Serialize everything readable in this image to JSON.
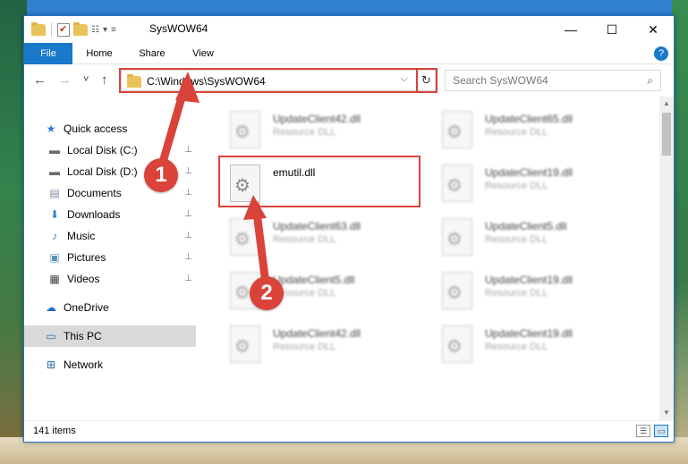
{
  "window": {
    "title": "SysWOW64",
    "controls": {
      "minimize": "—",
      "maximize": "☐",
      "close": "✕"
    },
    "qa_chevron": "▾"
  },
  "ribbon": {
    "tabs": [
      "File",
      "Home",
      "Share",
      "View"
    ],
    "help": "?"
  },
  "navigation": {
    "back": "←",
    "forward": "→",
    "recent": "˅",
    "up": "↑",
    "address": "C:\\Windows\\SysWOW64",
    "address_chevron": "⌵",
    "refresh": "↻",
    "search_placeholder": "Search SysWOW64",
    "search_icon": "⌕"
  },
  "sidebar": {
    "items": [
      {
        "label": "Quick access",
        "icon": "★",
        "color": "#2d7ad6",
        "pinned": false
      },
      {
        "label": "Local Disk (C:)",
        "icon": "▬",
        "color": "#6b6b6b",
        "pinned": true
      },
      {
        "label": "Local Disk (D:)",
        "icon": "▬",
        "color": "#6b6b6b",
        "pinned": true
      },
      {
        "label": "Documents",
        "icon": "▤",
        "color": "#7a8fa6",
        "pinned": true
      },
      {
        "label": "Downloads",
        "icon": "⬇",
        "color": "#2d7ad6",
        "pinned": true
      },
      {
        "label": "Music",
        "icon": "♪",
        "color": "#2d7ad6",
        "pinned": true
      },
      {
        "label": "Pictures",
        "icon": "▣",
        "color": "#5b8fb9",
        "pinned": true
      },
      {
        "label": "Videos",
        "icon": "▦",
        "color": "#444444",
        "pinned": true
      },
      {
        "label": "OneDrive",
        "icon": "☁",
        "color": "#1f6fc5",
        "pinned": false
      },
      {
        "label": "This PC",
        "icon": "▭",
        "color": "#2b6aa8",
        "pinned": false
      },
      {
        "label": "Network",
        "icon": "⊞",
        "color": "#2b6aa8",
        "pinned": false
      }
    ],
    "pin_glyph": "📌"
  },
  "files": {
    "left_column": [
      {
        "name": "UpdateClient42.dll",
        "type": "Resource DLL",
        "blurred": true
      },
      {
        "name": "emutil.dll",
        "type": "",
        "blurred": false
      },
      {
        "name": "UpdateClient63.dll",
        "type": "Resource DLL",
        "blurred": true
      },
      {
        "name": "UpdateClient5.dll",
        "type": "Resource DLL",
        "blurred": true
      },
      {
        "name": "UpdateClient42.dll",
        "type": "Resource DLL",
        "blurred": true
      }
    ],
    "right_column": [
      {
        "name": "UpdateClient65.dll",
        "type": "Resource DLL",
        "blurred": true
      },
      {
        "name": "UpdateClient19.dll",
        "type": "Resource DLL",
        "blurred": true
      },
      {
        "name": "UpdateClient5.dll",
        "type": "Resource DLL",
        "blurred": true
      },
      {
        "name": "UpdateClient19.dll",
        "type": "Resource DLL",
        "blurred": true
      },
      {
        "name": "UpdateClient19.dll",
        "type": "Resource DLL",
        "blurred": true
      }
    ]
  },
  "status": {
    "item_count": "141 items",
    "view_details": "☰",
    "view_icons": "▭"
  },
  "annotations": {
    "step1": "1",
    "step2": "2",
    "color": "#d9433a"
  }
}
